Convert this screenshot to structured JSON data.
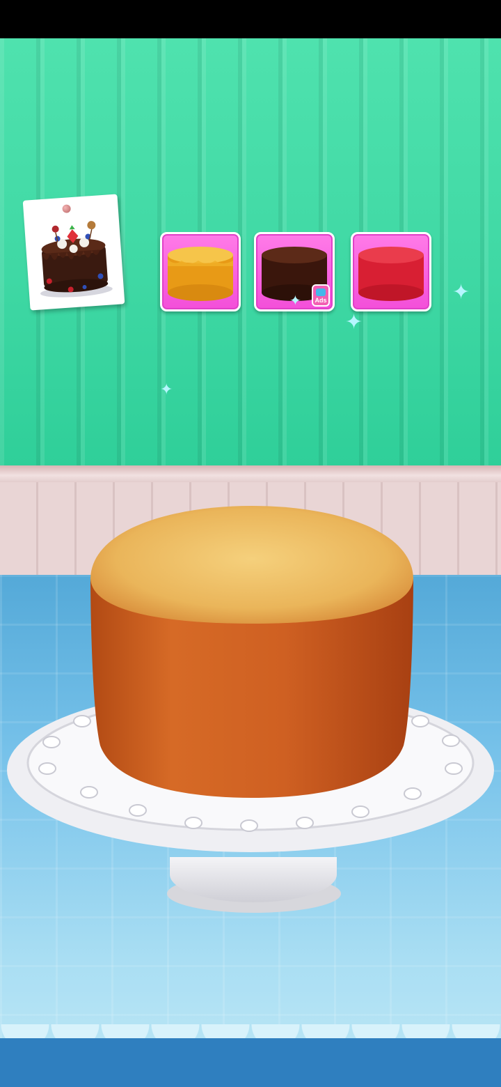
{
  "scene": {
    "recipe_card": {
      "icon": "chocolate-cake-icon"
    },
    "cake_options": [
      {
        "id": "vanilla",
        "icon": "vanilla-cake-icon",
        "color": "#f2a81c",
        "locked": false
      },
      {
        "id": "chocolate",
        "icon": "chocolate-cake-icon",
        "color": "#4a2014",
        "locked": true,
        "badge": "Ads"
      },
      {
        "id": "red-velvet",
        "icon": "red-velvet-cake-icon",
        "color": "#e02a3c",
        "locked": false
      }
    ],
    "main_cake": {
      "icon": "sponge-cake-icon",
      "color": "#c8581c"
    }
  },
  "colors": {
    "wall": "#3fd8a4",
    "option_tile": "#f34fd9",
    "counter": "#77c2ea"
  }
}
